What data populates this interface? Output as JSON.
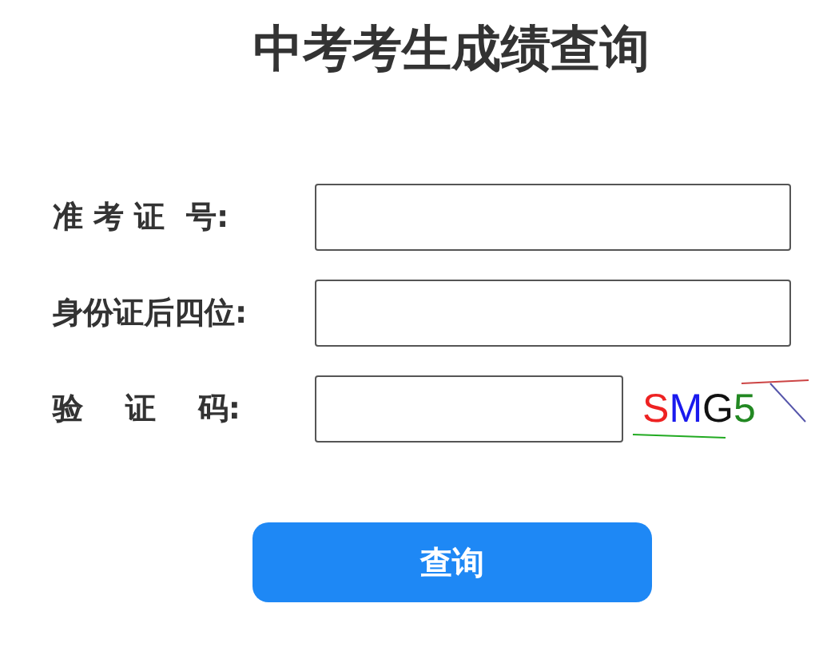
{
  "title": "中考考生成绩查询",
  "fields": [
    {
      "label": "准 考 证  号:"
    },
    {
      "label": "身份证后四位:"
    },
    {
      "label": "验    证    码:",
      "captcha": [
        {
          "char": "S",
          "color": "#ee2222"
        },
        {
          "char": "M",
          "color": "#1a1aee"
        },
        {
          "char": "G",
          "color": "#111111"
        },
        {
          "char": "5",
          "color": "#228822"
        }
      ]
    }
  ],
  "button": "查询"
}
